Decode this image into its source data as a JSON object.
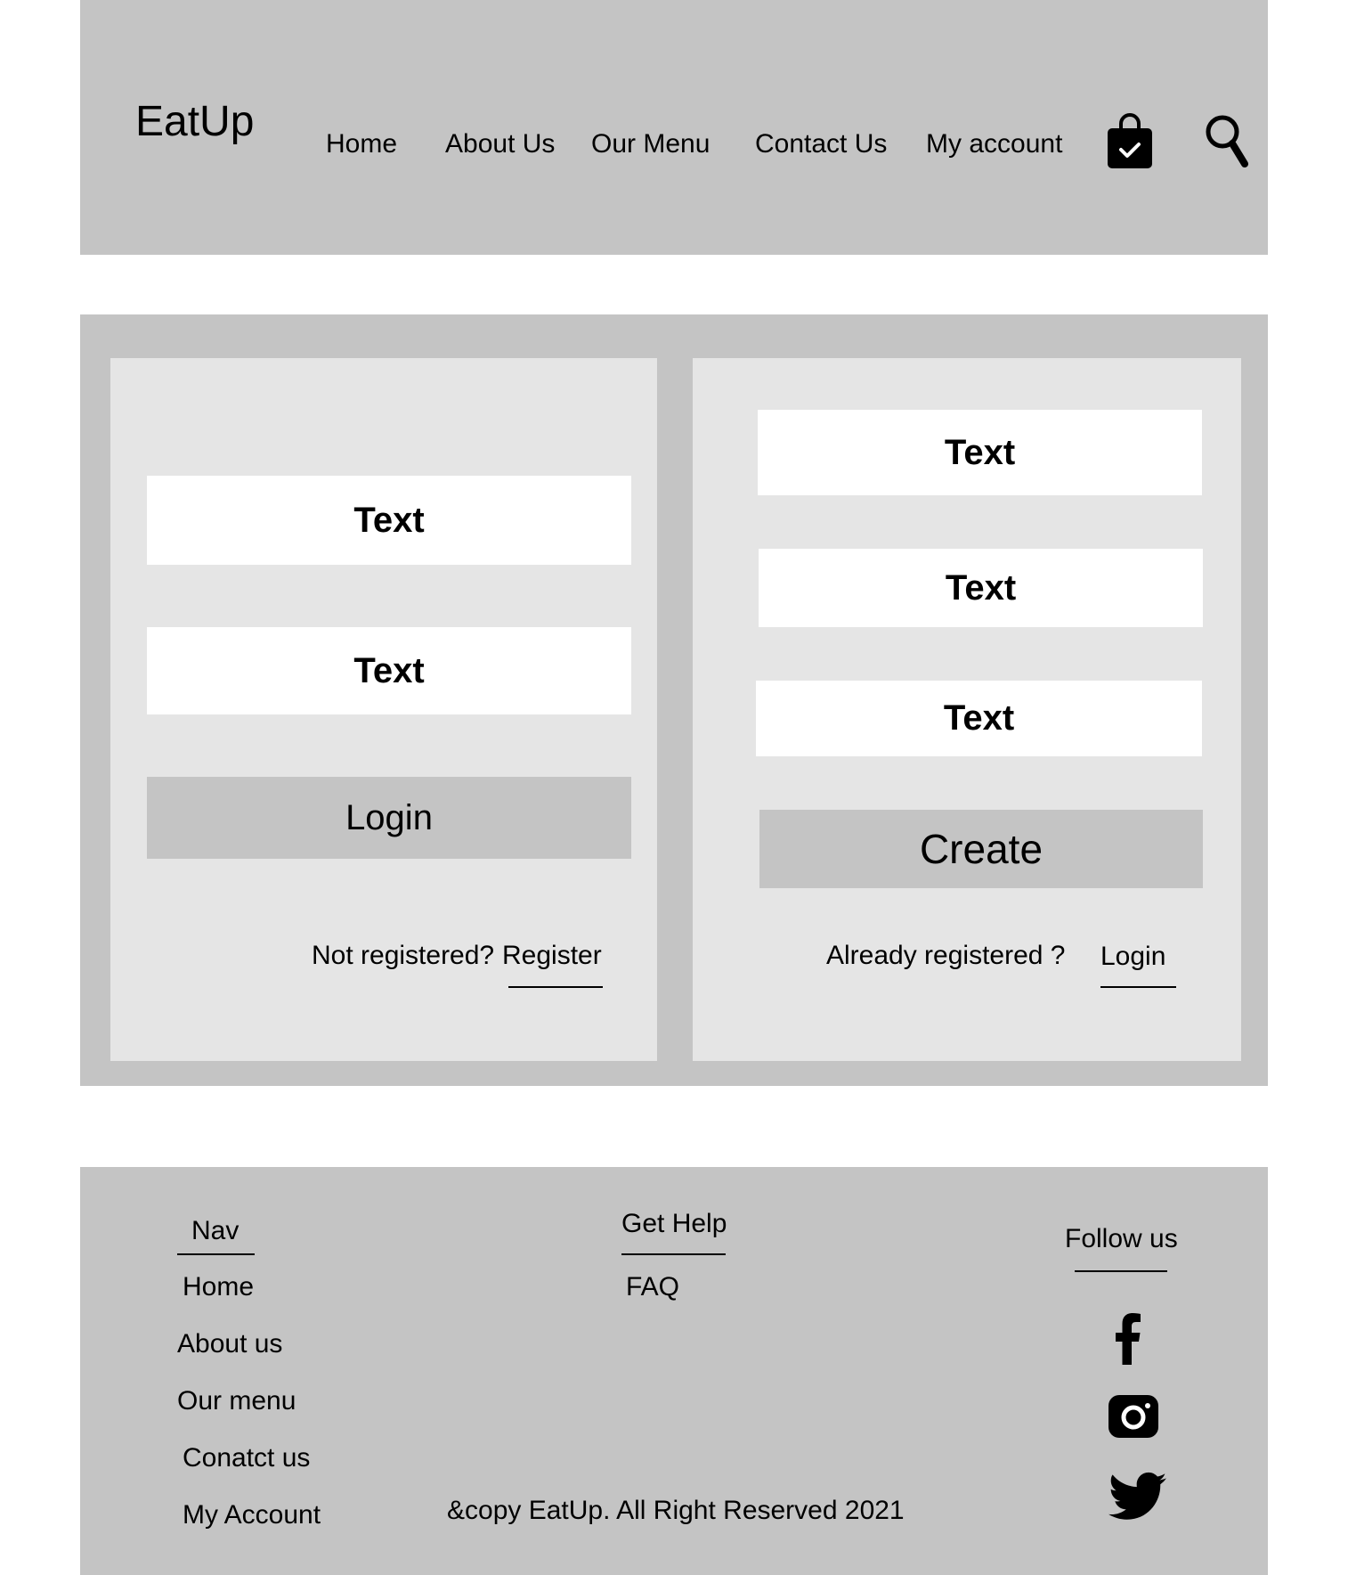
{
  "header": {
    "logo": "EatUp",
    "nav": [
      {
        "label": "Home"
      },
      {
        "label": "About Us"
      },
      {
        "label": "Our Menu"
      },
      {
        "label": "Contact Us"
      },
      {
        "label": "My account"
      }
    ],
    "icons": {
      "bag": "shopping-bag-check-icon",
      "search": "magnifier-search-icon"
    }
  },
  "login_panel": {
    "fields": [
      {
        "value": "Text"
      },
      {
        "value": "Text"
      }
    ],
    "button_label": "Login",
    "prompt": "Not registered?",
    "link_label": "Register"
  },
  "register_panel": {
    "fields": [
      {
        "value": "Text"
      },
      {
        "value": "Text"
      },
      {
        "value": "Text"
      }
    ],
    "button_label": "Create",
    "prompt": "Already registered ?",
    "link_label": "Login"
  },
  "footer": {
    "nav_heading": "Nav",
    "nav_links": [
      {
        "label": "Home"
      },
      {
        "label": "About us"
      },
      {
        "label": "Our menu"
      },
      {
        "label": "Conatct us"
      },
      {
        "label": "My Account"
      }
    ],
    "help_heading": "Get Help",
    "help_links": [
      {
        "label": "FAQ"
      }
    ],
    "follow_heading": "Follow us",
    "social": [
      "facebook-icon",
      "instagram-icon",
      "twitter-icon"
    ],
    "copyright": "&copy EatUp. All Right Reserved 2021"
  },
  "colors": {
    "panel_dark": "#c4c4c4",
    "panel_light": "#e5e5e5",
    "field": "#ffffff",
    "text": "#000000"
  }
}
